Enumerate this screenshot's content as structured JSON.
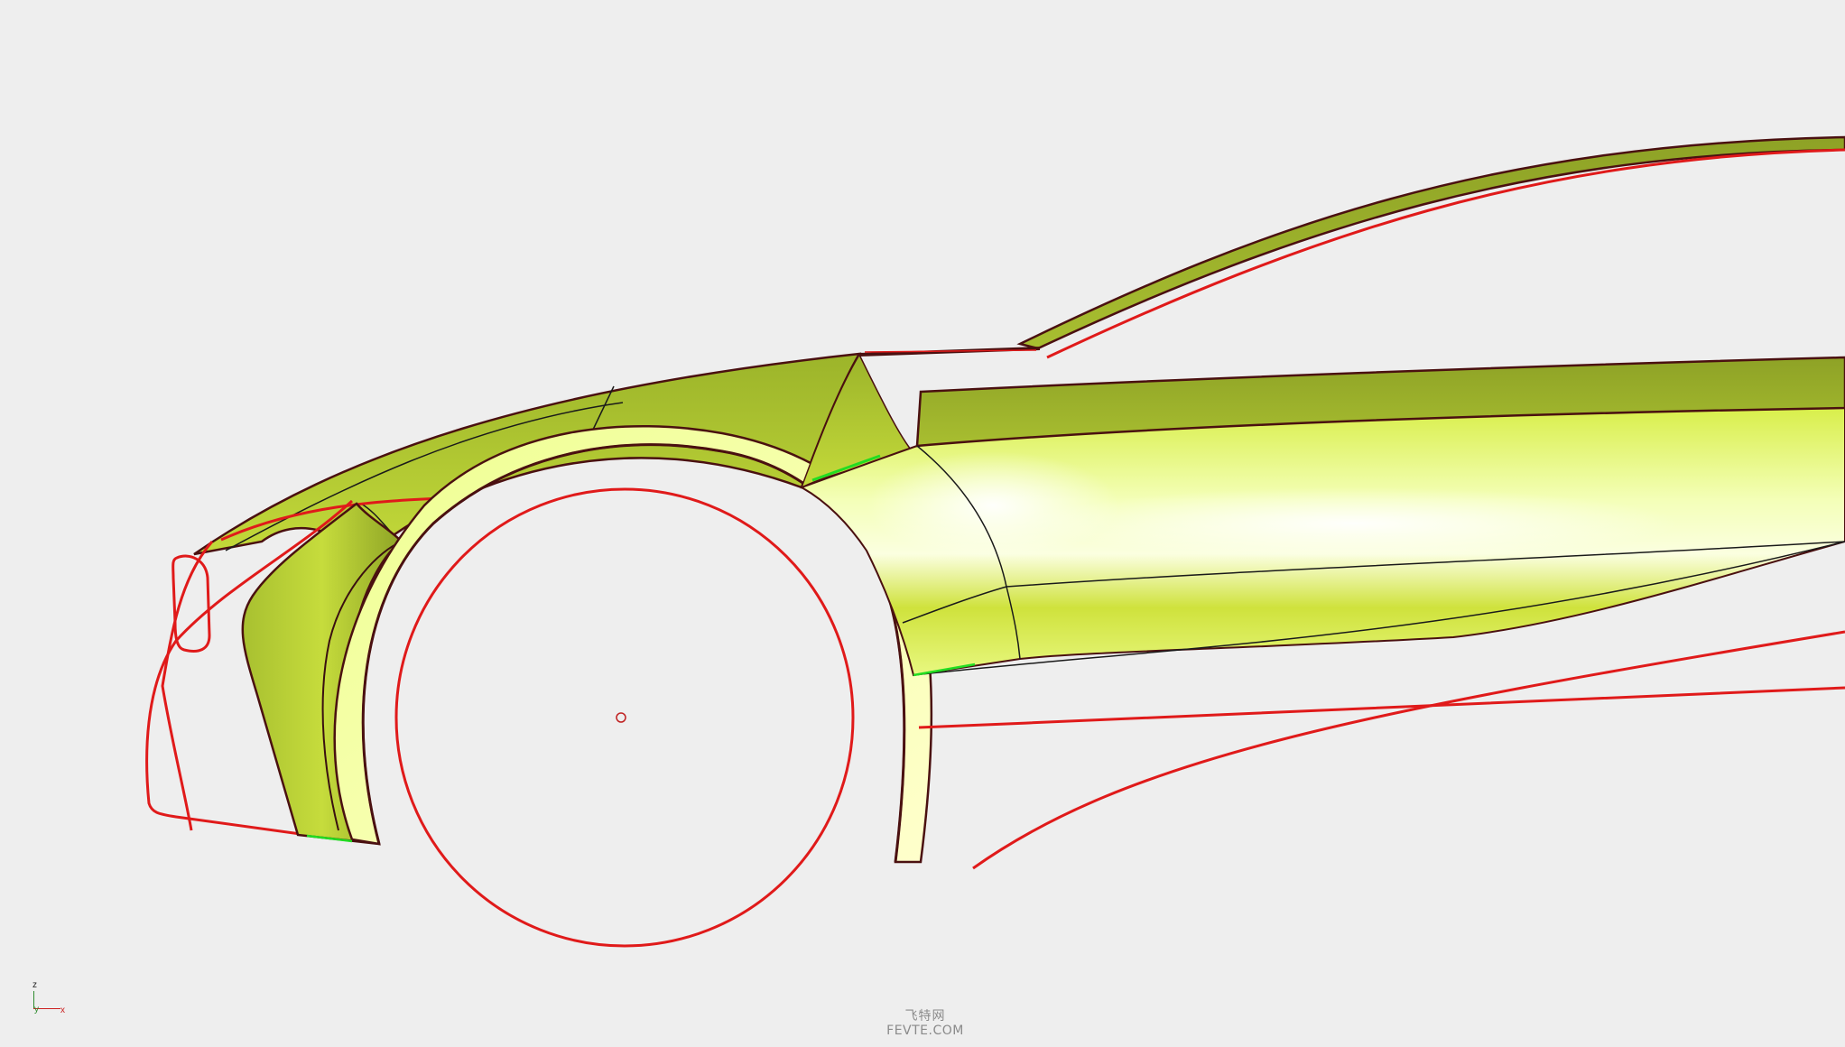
{
  "viewport": {
    "background": "#eeeeee",
    "axis_labels": {
      "z": "z",
      "y": "y",
      "x": "x"
    }
  },
  "watermark": {
    "line1": "飞特网",
    "line2": "FEVTE.COM"
  },
  "colors": {
    "curve_red": "#e01a1a",
    "surface_light": "#f6ffb0",
    "surface_mid": "#c8dc3c",
    "surface_dark": "#8fa424",
    "edge_dark": "#4a1010",
    "seam_green": "#22dd22"
  }
}
